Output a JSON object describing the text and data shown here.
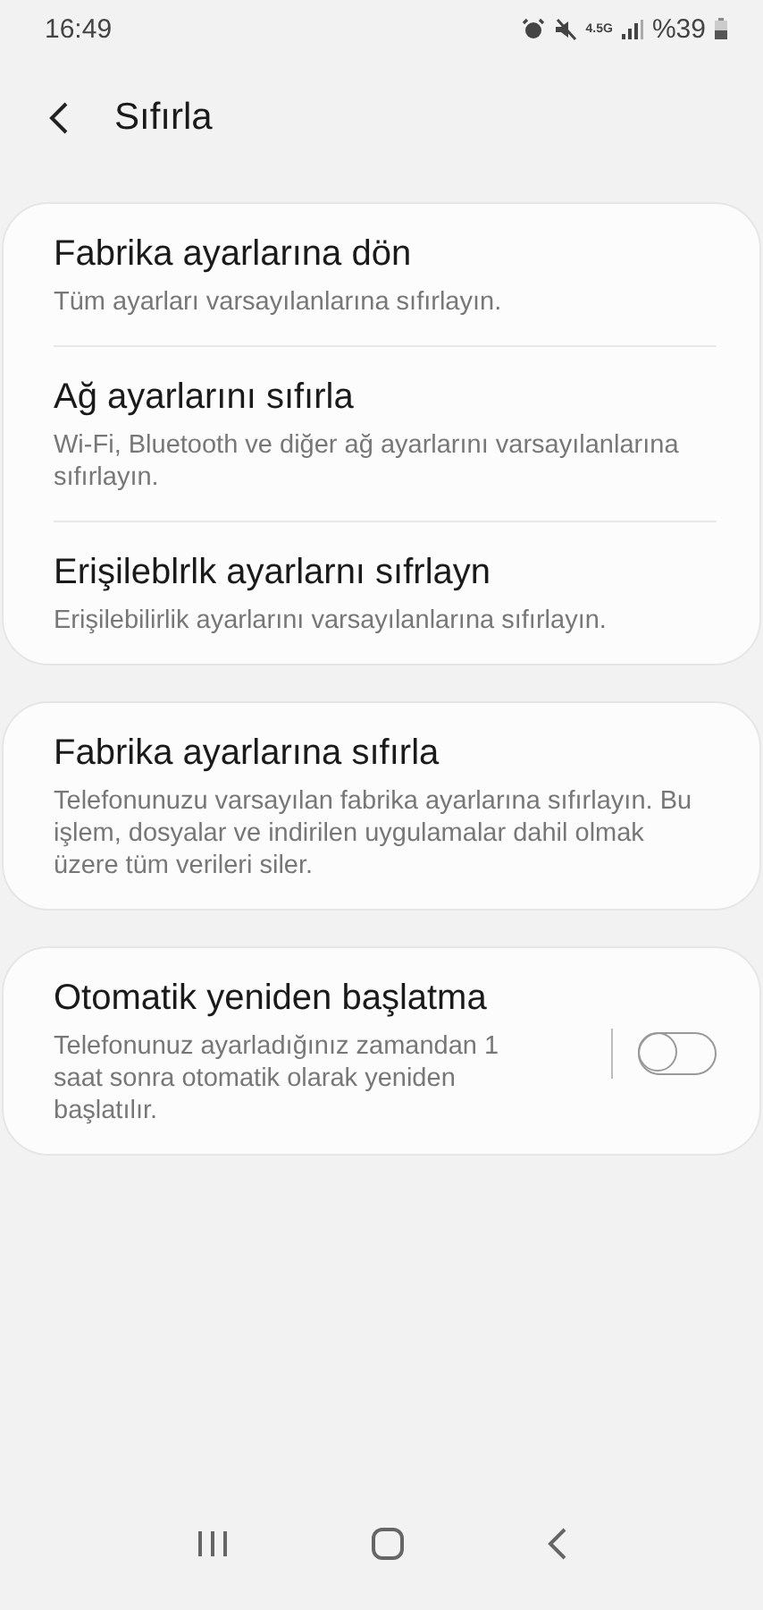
{
  "status_bar": {
    "time": "16:49",
    "network": "4.5G",
    "battery": "%39"
  },
  "header": {
    "title": "Sıfırla"
  },
  "groups": [
    {
      "items": [
        {
          "kind": "plain",
          "title": "Fabrika ayarlarına dön",
          "subtitle": "Tüm ayarları varsayılanlarına sıfırlayın."
        },
        {
          "kind": "plain",
          "title": "Ağ ayarlarını sıfırla",
          "subtitle": "Wi-Fi, Bluetooth ve diğer ağ ayarlarını varsayılanlarına sıfırlayın."
        },
        {
          "kind": "plain",
          "title": "Erişileblrlk ayarlarnı sıfrlayn",
          "subtitle": "Erişilebilirlik ayarlarını varsayılanlarına sıfırlayın."
        }
      ]
    },
    {
      "items": [
        {
          "kind": "plain",
          "title": "Fabrika ayarlarına sıfırla",
          "subtitle": "Telefonunuzu varsayılan fabrika ayarlarına sıfırlayın. Bu işlem, dosyalar ve indirilen uygulamalar dahil olmak üzere tüm verileri siler."
        }
      ]
    },
    {
      "items": [
        {
          "kind": "toggle",
          "title": "Otomatik yeniden başlatma",
          "subtitle": "Telefonunuz ayarladığınız zamandan 1 saat sonra otomatik olarak yeniden başlatılır.",
          "on": false
        }
      ]
    }
  ]
}
